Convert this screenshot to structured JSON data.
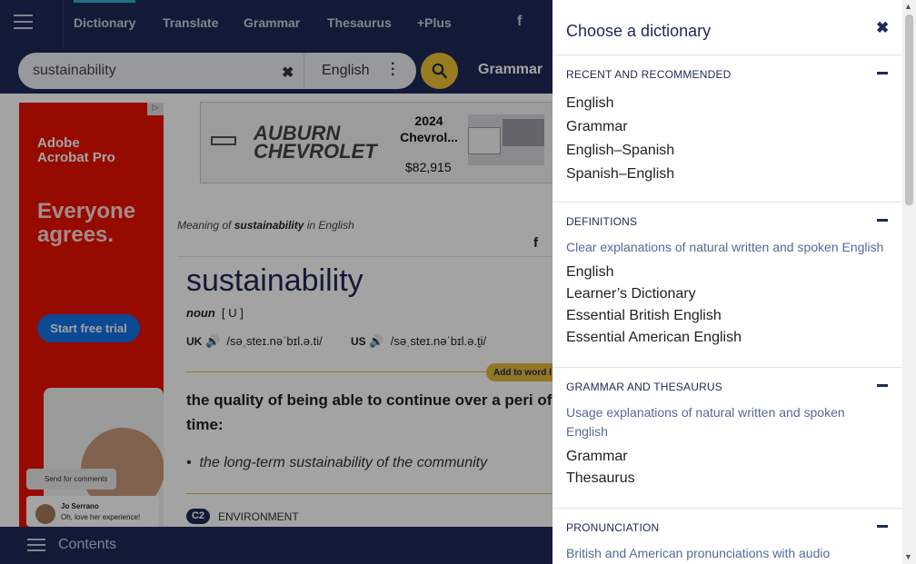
{
  "nav": {
    "links": [
      "Dictionary",
      "Translate",
      "Grammar",
      "Thesaurus",
      "+Plus"
    ],
    "facebook": "f"
  },
  "search": {
    "value": "sustainability",
    "clear": "✖",
    "language": "English",
    "grammar_link": "Grammar"
  },
  "ads": {
    "left": {
      "brand_line1": "Adobe",
      "brand_line2": "Acrobat Pro",
      "headline_line1": "Everyone",
      "headline_line2": "agrees.",
      "cta": "Start free trial",
      "comment": "Send for comments",
      "user": "Jo Serrano",
      "user_msg": "Oh, love her experience!"
    },
    "top": {
      "dealer_line1": "AUBURN",
      "dealer_line2": "CHEVROLET",
      "model_year": "2024",
      "model": "Chevrol...",
      "price": "$82,915"
    }
  },
  "entry": {
    "meaning_prefix": "Meaning of ",
    "meaning_word": "sustainability",
    "meaning_suffix": " in English",
    "headword": "sustainability",
    "pos": "noun",
    "grammar": "[ U ]",
    "uk_label": "UK",
    "uk_ipa": "/səˌsteɪ.nəˈbɪl.ə.ti/",
    "us_label": "US",
    "us_ipa": "/səˌsteɪ.nəˈbɪl.ə.t̬i/",
    "add_word": "Add to word l",
    "definition": "the quality of being able to continue over a peri of time:",
    "example": "the long-term sustainability of the community",
    "level": "C2",
    "topic": "ENVIRONMENT"
  },
  "bottom": {
    "contents": "Contents"
  },
  "panel": {
    "title": "Choose a dictionary",
    "close": "✖",
    "sections": [
      {
        "heading": "RECENT AND RECOMMENDED",
        "description": "",
        "items": [
          "English",
          "Grammar",
          "English–Spanish",
          "Spanish–English"
        ]
      },
      {
        "heading": "DEFINITIONS",
        "description": "Clear explanations of natural written and spoken English",
        "items": [
          "English",
          "Learner’s Dictionary",
          "Essential British English",
          "Essential American English"
        ]
      },
      {
        "heading": "GRAMMAR AND THESAURUS",
        "description": "Usage explanations of natural written and spoken English",
        "items": [
          "Grammar",
          "Thesaurus"
        ]
      },
      {
        "heading": "PRONUNCIATION",
        "description": "British and American pronunciations with audio",
        "items": []
      }
    ]
  },
  "colors": {
    "navy": "#1d2a57",
    "accent_yellow": "#f0c232",
    "accent_teal": "#2ab1c9",
    "adobe_red": "#eb1000"
  }
}
